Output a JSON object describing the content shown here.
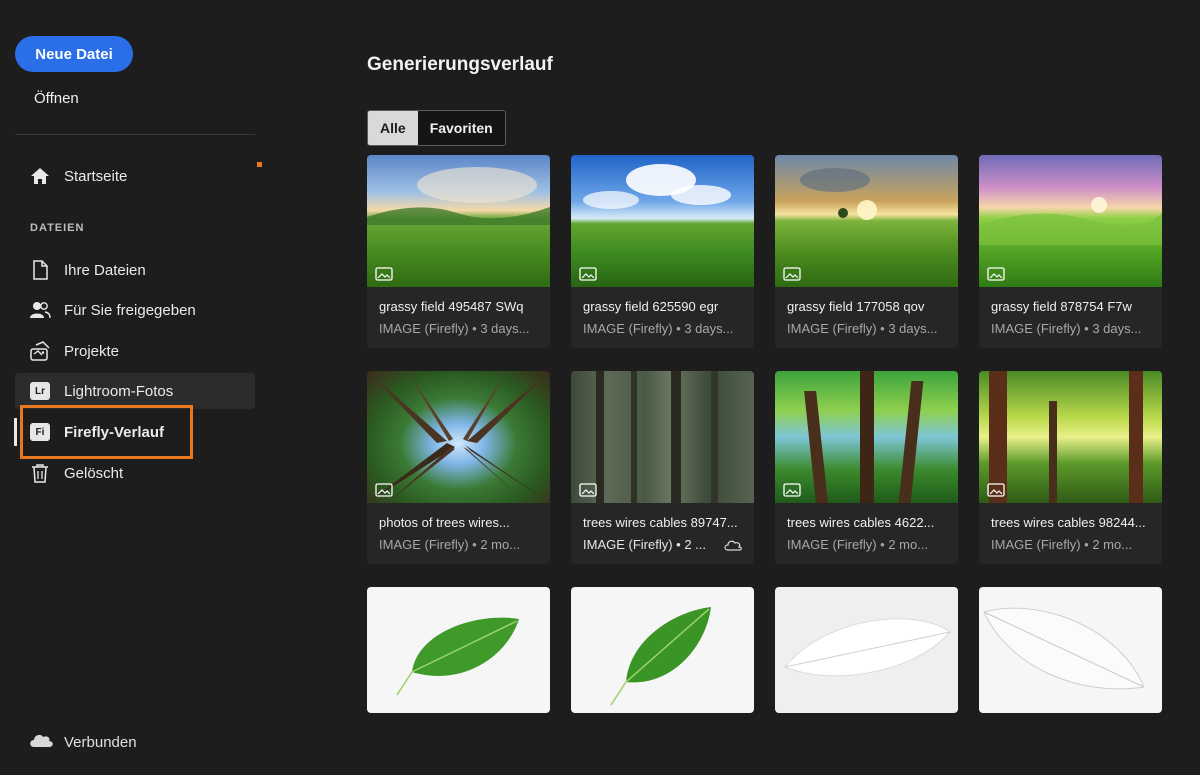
{
  "sidebar": {
    "new_file_label": "Neue Datei",
    "open_label": "Öffnen",
    "home_label": "Startseite",
    "section_files": "DATEIEN",
    "items": [
      {
        "label": "Ihre Dateien",
        "icon": "file-icon"
      },
      {
        "label": "Für Sie freigegeben",
        "icon": "shared-users-icon"
      },
      {
        "label": "Projekte",
        "icon": "projects-icon"
      },
      {
        "label": "Lightroom-Fotos",
        "icon": "lightroom-icon",
        "badge": "Lr"
      },
      {
        "label": "Firefly-Verlauf",
        "icon": "firefly-icon",
        "badge": "Fi"
      },
      {
        "label": "Gelöscht",
        "icon": "trash-icon"
      }
    ],
    "status_label": "Verbunden",
    "colors": {
      "accent": "#2a6fe8",
      "highlight": "#e8771d"
    }
  },
  "main": {
    "title": "Generierungsverlauf",
    "filters": [
      {
        "label": "Alle",
        "selected": true
      },
      {
        "label": "Favoriten",
        "selected": false
      }
    ],
    "cards": [
      {
        "title": "grassy field 495487 SWq",
        "meta": "IMAGE (Firefly) • 3 days..."
      },
      {
        "title": "grassy field 625590 egr",
        "meta": "IMAGE (Firefly) • 3 days..."
      },
      {
        "title": "grassy field 177058 qov",
        "meta": "IMAGE (Firefly) • 3 days..."
      },
      {
        "title": "grassy field 878754 F7w",
        "meta": "IMAGE (Firefly) • 3 days..."
      },
      {
        "title": "photos of trees wires...",
        "meta": "IMAGE (Firefly) • 2 mo..."
      },
      {
        "title": "trees wires cables 89747...",
        "meta": "IMAGE (Firefly) • 2 ..."
      },
      {
        "title": "trees wires cables 4622...",
        "meta": "IMAGE (Firefly) • 2 mo..."
      },
      {
        "title": "trees wires cables 98244...",
        "meta": "IMAGE (Firefly) • 2 mo..."
      }
    ]
  }
}
